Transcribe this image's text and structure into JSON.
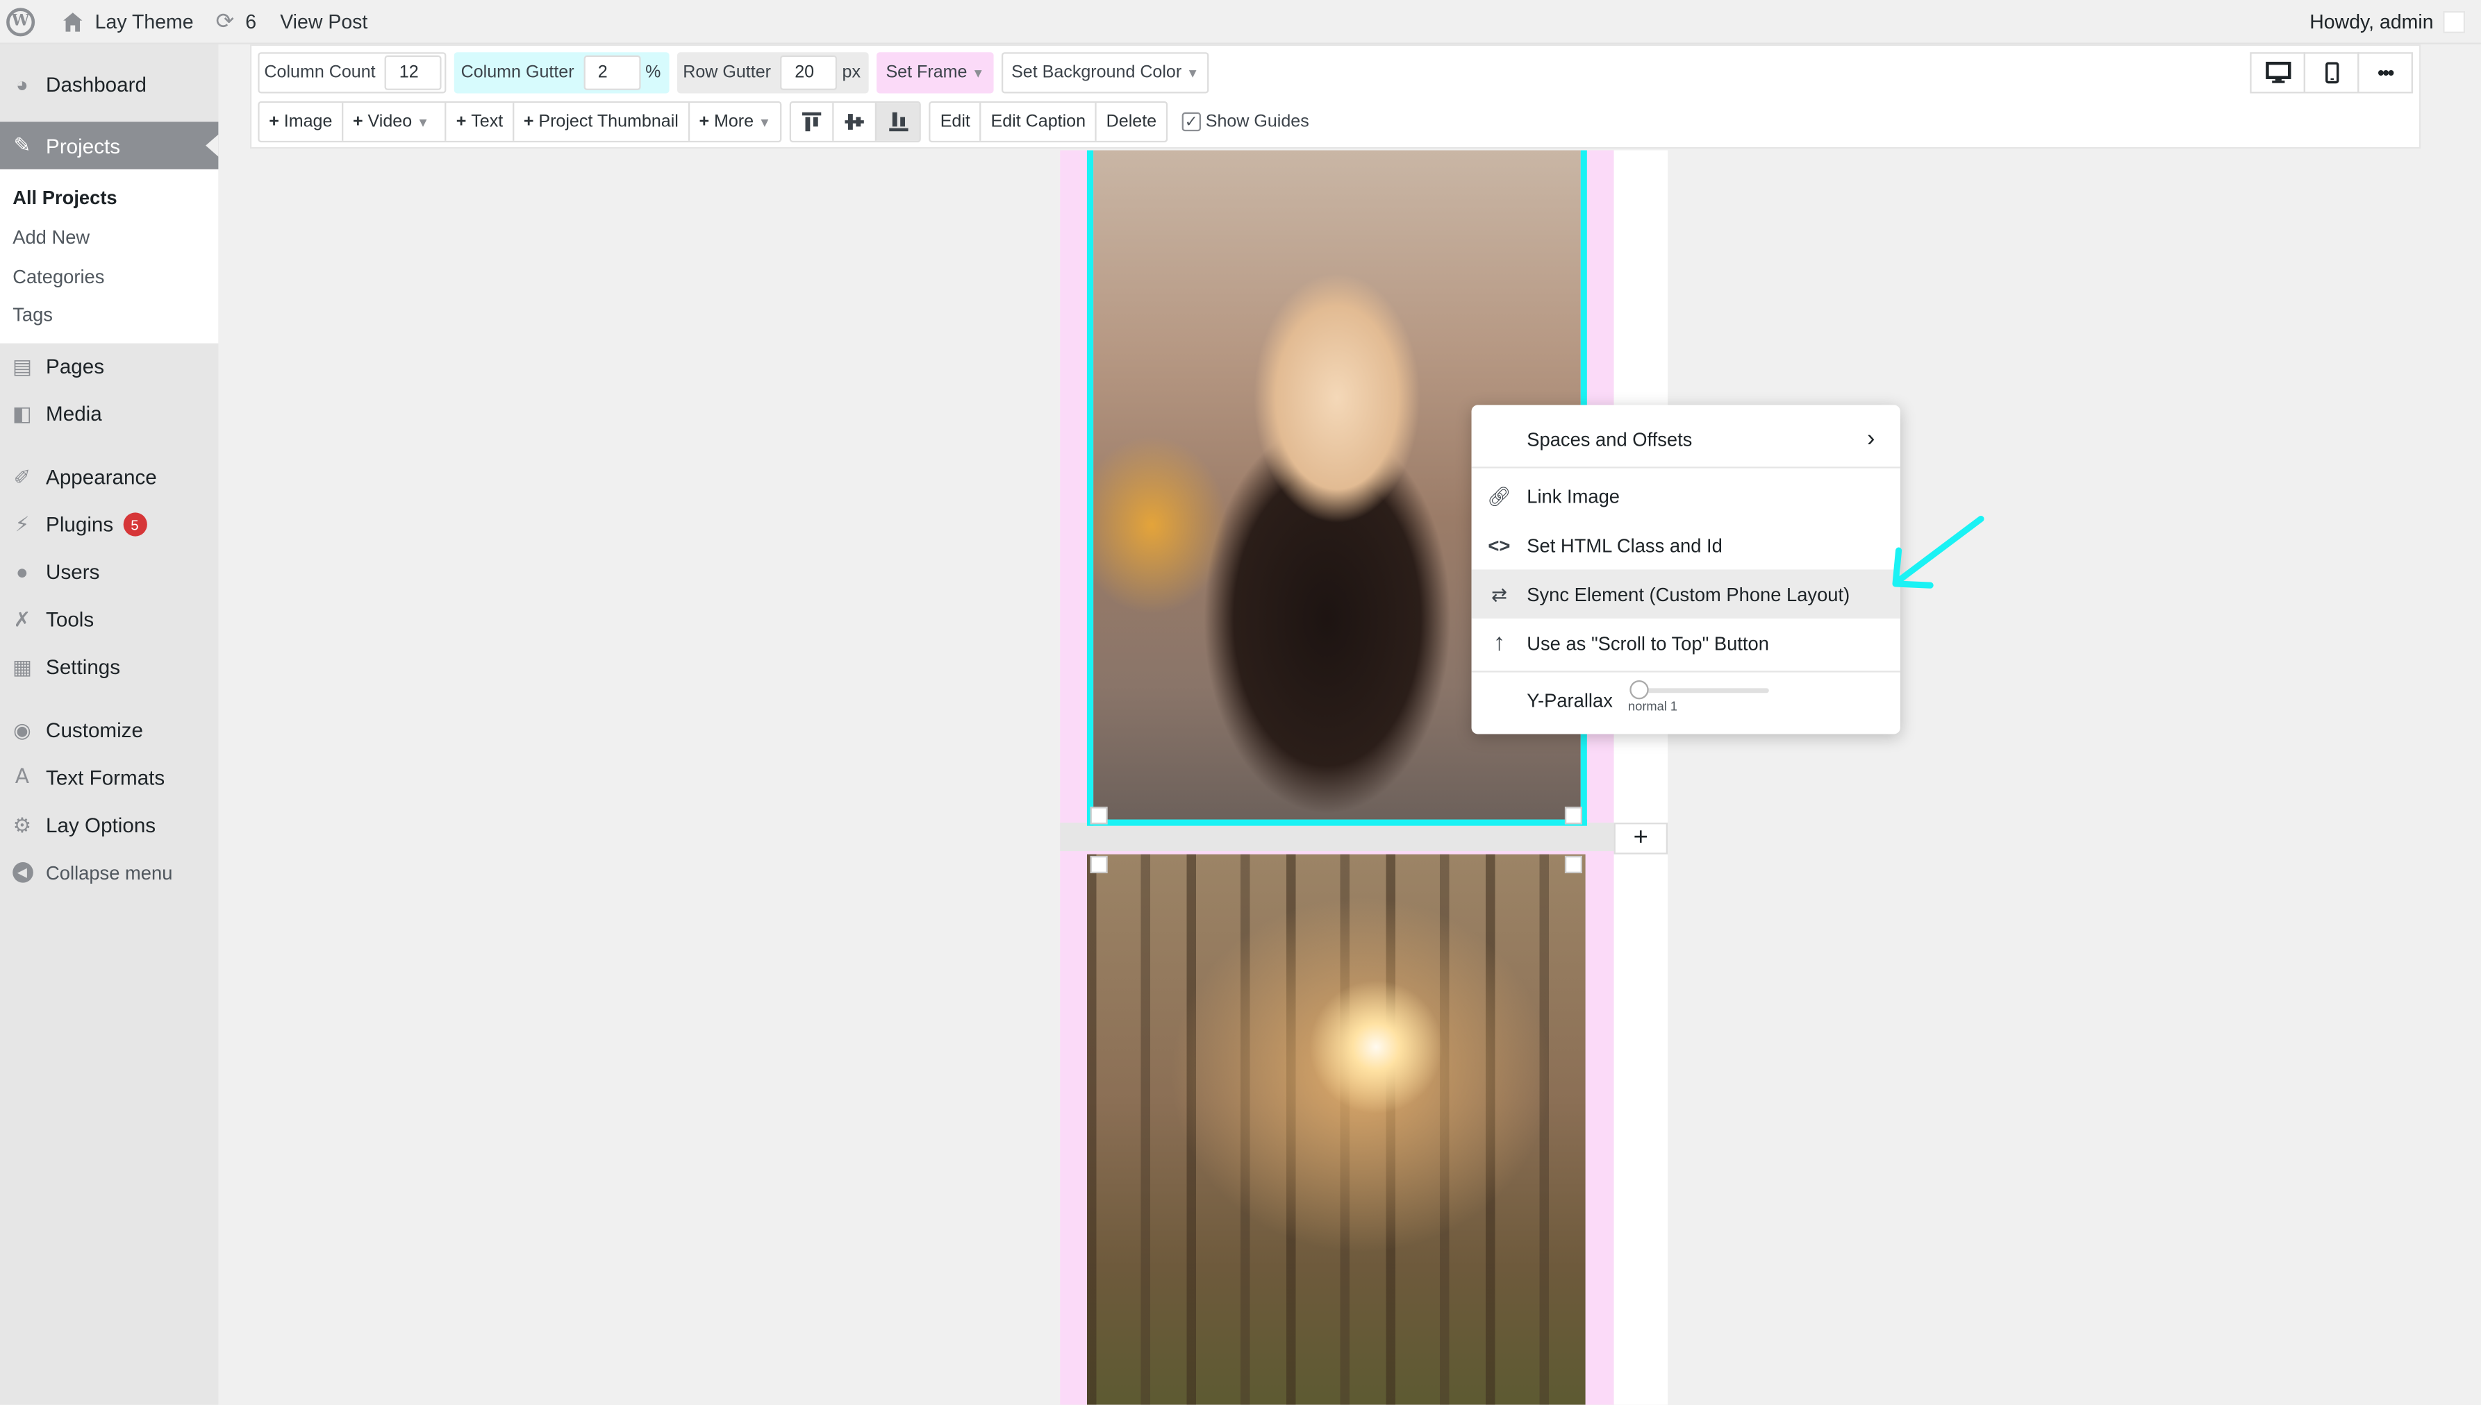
{
  "adminbar": {
    "site_name": "Lay Theme",
    "updates_count": "6",
    "view_post": "View Post",
    "howdy": "Howdy, admin"
  },
  "sidebar": {
    "dashboard": "Dashboard",
    "projects": "Projects",
    "projects_sub": [
      "All Projects",
      "Add New",
      "Categories",
      "Tags"
    ],
    "pages": "Pages",
    "media": "Media",
    "appearance": "Appearance",
    "plugins": "Plugins",
    "plugins_badge": "5",
    "users": "Users",
    "tools": "Tools",
    "settings": "Settings",
    "customize": "Customize",
    "text_formats": "Text Formats",
    "lay_options": "Lay Options",
    "collapse": "Collapse menu"
  },
  "toolbar": {
    "column_count_label": "Column Count",
    "column_count_value": "12",
    "column_gutter_label": "Column Gutter",
    "column_gutter_value": "2",
    "column_gutter_unit": "%",
    "row_gutter_label": "Row Gutter",
    "row_gutter_value": "20",
    "row_gutter_unit": "px",
    "set_frame": "Set Frame",
    "set_bg_color": "Set Background Color",
    "add_image": "Image",
    "add_video": "Video",
    "add_text": "Text",
    "add_project_thumbnail": "Project Thumbnail",
    "add_more": "More",
    "edit": "Edit",
    "edit_caption": "Edit Caption",
    "delete": "Delete",
    "show_guides": "Show Guides",
    "show_guides_checked": true
  },
  "context_menu": {
    "spaces_and_offsets": "Spaces and Offsets",
    "link_image": "Link Image",
    "set_html_class": "Set HTML Class and Id",
    "sync_element": "Sync Element (Custom Phone Layout)",
    "scroll_to_top": "Use as \"Scroll to Top\" Button",
    "y_parallax_label": "Y-Parallax",
    "y_parallax_value": "normal 1"
  },
  "colors": {
    "selection_border": "#1af2f4",
    "column_guides": "#fbdaf8",
    "annotation_arrow": "#1af2f4",
    "badge": "#d63638"
  }
}
